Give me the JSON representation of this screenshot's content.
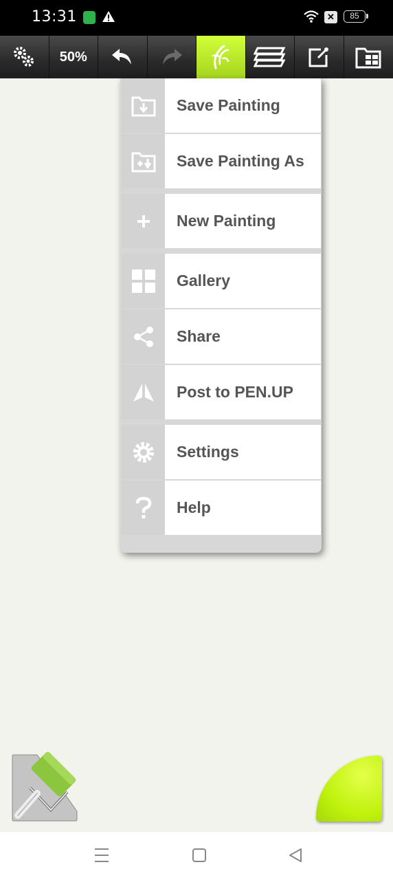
{
  "status_bar": {
    "time": "13:31",
    "battery": "85",
    "icons": [
      "app-notification-icon",
      "warning-icon",
      "wifi-icon",
      "sim-disabled-icon",
      "battery-icon"
    ]
  },
  "toolbar": {
    "zoom": "50%",
    "buttons": [
      "settings-gears-icon",
      "zoom-level",
      "undo-icon",
      "redo-icon",
      "brush-mode-icon",
      "layers-icon",
      "export-icon",
      "file-menu-icon"
    ],
    "active_color": "#c4f020"
  },
  "menu": {
    "items": [
      {
        "label": "Save Painting",
        "icon": "folder-save-icon"
      },
      {
        "label": "Save Painting As",
        "icon": "folder-save-as-icon"
      },
      {
        "label": "New Painting",
        "icon": "plus-icon"
      },
      {
        "label": "Gallery",
        "icon": "grid-icon"
      },
      {
        "label": "Share",
        "icon": "share-icon"
      },
      {
        "label": "Post to PEN.UP",
        "icon": "penup-icon"
      },
      {
        "label": "Settings",
        "icon": "gear-icon"
      },
      {
        "label": "Help",
        "icon": "question-icon"
      }
    ]
  },
  "bottom_tools": {
    "brush": "paint-roller-icon",
    "color": "#c8f510"
  },
  "nav_bar": {
    "buttons": [
      "recent-apps-icon",
      "home-icon",
      "back-icon"
    ]
  }
}
